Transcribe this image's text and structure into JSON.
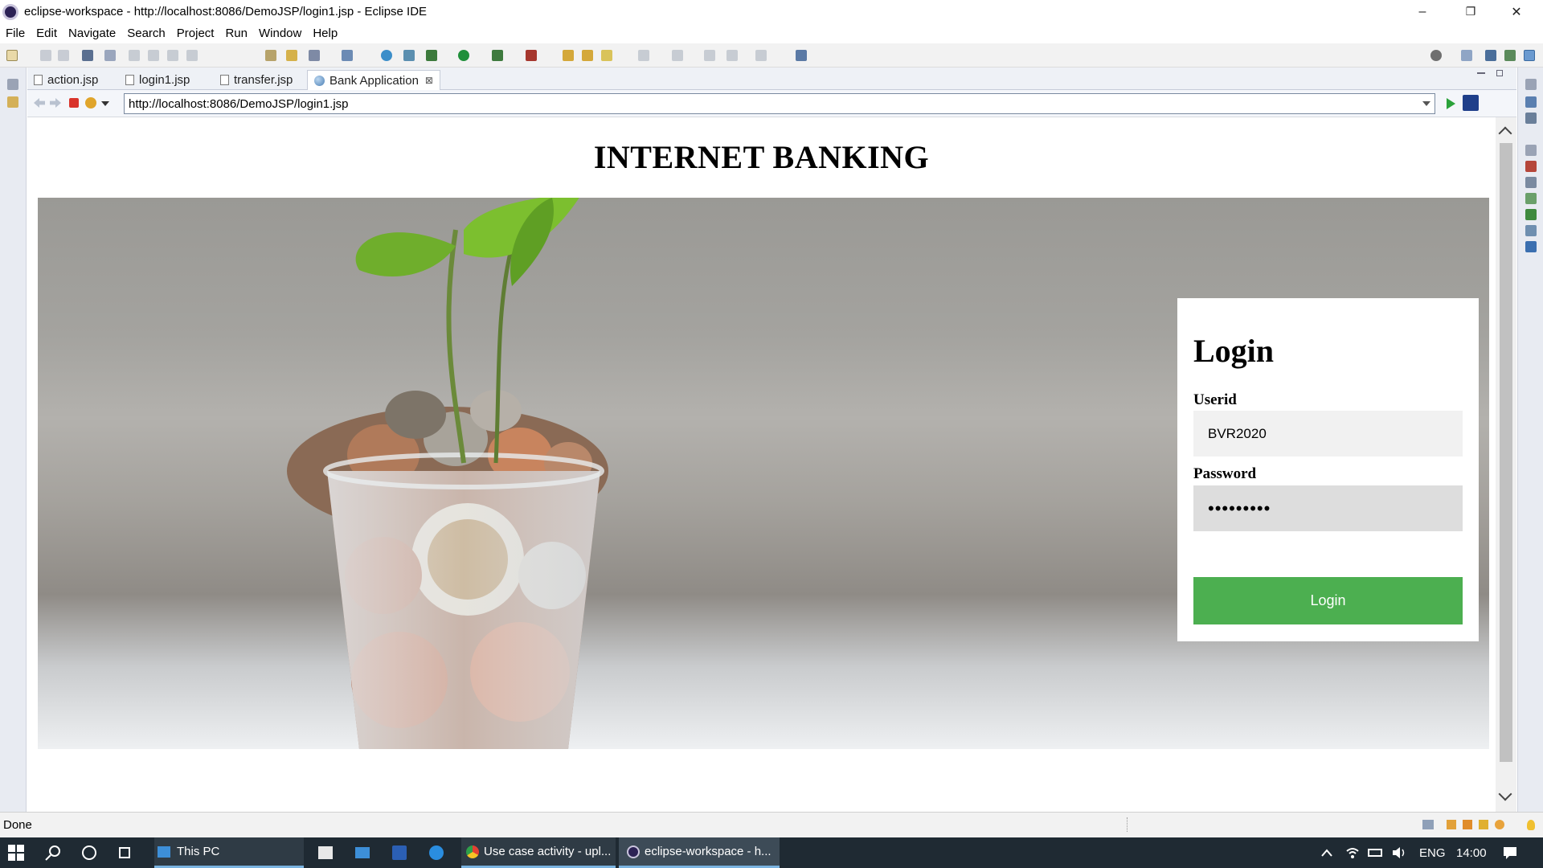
{
  "window": {
    "title": "eclipse-workspace - http://localhost:8086/DemoJSP/login1.jsp - Eclipse IDE",
    "minimize": "–",
    "restore": "❐",
    "close": "✕"
  },
  "menu": [
    "File",
    "Edit",
    "Navigate",
    "Search",
    "Project",
    "Run",
    "Window",
    "Help"
  ],
  "tabs": [
    {
      "label": "action.jsp"
    },
    {
      "label": "login1.jsp"
    },
    {
      "label": "transfer.jsp"
    },
    {
      "label": "Bank Application",
      "active": true,
      "close": "⊠"
    }
  ],
  "browser": {
    "url": "http://localhost:8086/DemoJSP/login1.jsp"
  },
  "page": {
    "heading": "INTERNET BANKING",
    "login": {
      "title": "Login",
      "userid_label": "Userid",
      "userid_value": "BVR2020",
      "password_label": "Password",
      "password_mask": "•••••••••",
      "button": "Login"
    }
  },
  "status": "Done",
  "taskbar": {
    "items": [
      "This PC",
      "Use case activity - upl...",
      "eclipse-workspace - h..."
    ],
    "lang": "ENG",
    "time": "14:00"
  },
  "colors": {
    "login_button": "#4caf50",
    "taskbar": "#1f2a33"
  }
}
